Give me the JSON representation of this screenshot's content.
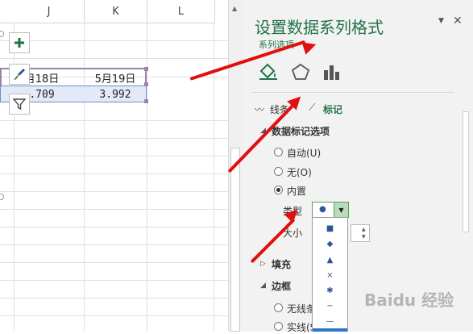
{
  "sheet": {
    "columns": [
      "J",
      "K",
      "L"
    ],
    "row1": [
      "月18日",
      "5月19日"
    ],
    "row2": [
      ".709",
      "3.992"
    ]
  },
  "pane": {
    "title": "设置数据系列格式",
    "subtitle": "系列选项",
    "close_glyph": "✕",
    "dropdown_glyph": "▼",
    "tabs": [
      "线条",
      "标记"
    ],
    "section_marker_options": "数据标记选项",
    "radio_auto": "自动(U)",
    "radio_none": "无(O)",
    "radio_builtin": "内置",
    "type_label": "类型",
    "size_label": "大小",
    "section_fill": "填充",
    "section_border": "边框",
    "border_none": "无线条",
    "border_solid": "实线(S"
  },
  "marker_list": [
    "■",
    "◆",
    "▲",
    "×",
    "✱",
    "−",
    "—"
  ],
  "watermark": "Baidu 经验",
  "colors": {
    "accent": "#217346",
    "arrow": "#e01010",
    "selection": "#9a83b0",
    "marker": "#2f5597"
  }
}
